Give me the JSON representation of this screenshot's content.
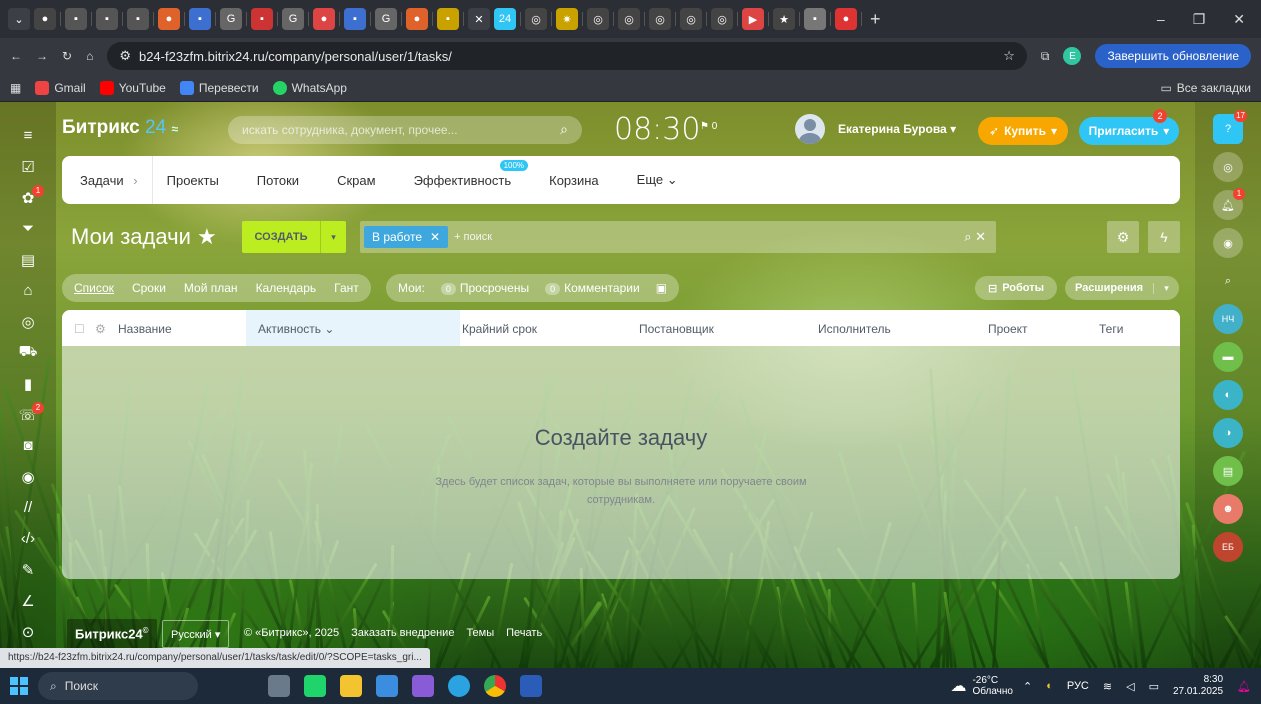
{
  "browser": {
    "url": "b24-f23zfm.bitrix24.ru/company/personal/user/1/tasks/",
    "update_button": "Завершить обновление",
    "bookmarks": [
      "Gmail",
      "YouTube",
      "Перевести",
      "WhatsApp"
    ],
    "all_bookmarks": "Все закладки",
    "status_link": "https://b24-f23zfm.bitrix24.ru/company/personal/user/1/tasks/task/edit/0/?SCOPE=tasks_gri..."
  },
  "header": {
    "logo": "Битрикс",
    "logo_num": "24",
    "search_placeholder": "искать сотрудника, документ, прочее...",
    "clock": "08:30",
    "clock_flag": "0",
    "user_name": "Екатерина Бурова",
    "buy_label": "Купить",
    "invite_label": "Пригласить",
    "invite_badge": "2"
  },
  "nav": {
    "tasks": "Задачи",
    "projects": "Проекты",
    "flows": "Потоки",
    "scrum": "Скрам",
    "efficiency": "Эффективность",
    "efficiency_badge": "100%",
    "trash": "Корзина",
    "more": "Еще"
  },
  "title": {
    "text": "Мои задачи",
    "create": "СОЗДАТЬ",
    "filter_tag": "В работе",
    "filter_placeholder": "+ поиск"
  },
  "views": {
    "list": "Список",
    "deadlines": "Сроки",
    "myplan": "Мой план",
    "calendar": "Календарь",
    "gantt": "Гант",
    "mine_label": "Мои:",
    "overdue_count": "0",
    "overdue": "Просрочены",
    "comments_count": "0",
    "comments": "Комментарии",
    "robots": "Роботы",
    "extensions": "Расширения"
  },
  "grid": {
    "columns": [
      "Название",
      "Активность",
      "Крайний срок",
      "Постановщик",
      "Исполнитель",
      "Проект",
      "Теги"
    ],
    "empty_title": "Создайте задачу",
    "empty_text": "Здесь будет список задач, которые вы выполняете или поручаете своим сотрудникам."
  },
  "footer": {
    "logo": "Битрикс24",
    "lang": "Русский",
    "links": [
      "© «Битрикс», 2025",
      "Заказать внедрение",
      "Темы",
      "Печать"
    ]
  },
  "right_sidebar": {
    "notify_badge": "17",
    "avatars": [
      "НЧ",
      "ЕБ"
    ]
  },
  "taskbar": {
    "search": "Поиск",
    "temperature": "-26°C",
    "weather": "Облачно",
    "lang": "РУС",
    "time": "8:30",
    "date": "27.01.2025"
  },
  "colors": {
    "accent_blue": "#2fc6f6",
    "create_green": "#bbed21",
    "buy_orange": "#f7a700",
    "badge_red": "#f0432f"
  }
}
